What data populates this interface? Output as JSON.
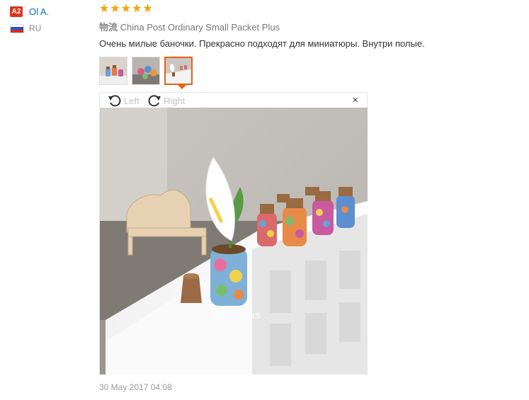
{
  "user": {
    "badge": "A2",
    "name": "Ol A.",
    "country_code": "RU"
  },
  "review": {
    "rating_out_of_5": 5,
    "shipping_label": "物流",
    "shipping_method": "China Post Ordinary Small Packet Plus",
    "comment": "Очень милые баночки. Прекрасно подходят для миниатюры. Внутри полые.",
    "thumbnails": [
      "photo-1",
      "photo-2",
      "photo-3"
    ],
    "active_thumbnail_index": 2,
    "date": "30 May 2017 04:08"
  },
  "viewer": {
    "rotate_left_label": "Left",
    "rotate_right_label": "Right",
    "close_symbol": "×",
    "watermark": "@nayo.xs"
  },
  "colors": {
    "badge_bg": "#d8371d",
    "username": "#0b6bb3",
    "star": "#f5a300",
    "active_border": "#e96112"
  },
  "icons": [
    "rotate-left-icon",
    "rotate-right-icon",
    "close-icon",
    "star-icon",
    "flag-icon"
  ]
}
